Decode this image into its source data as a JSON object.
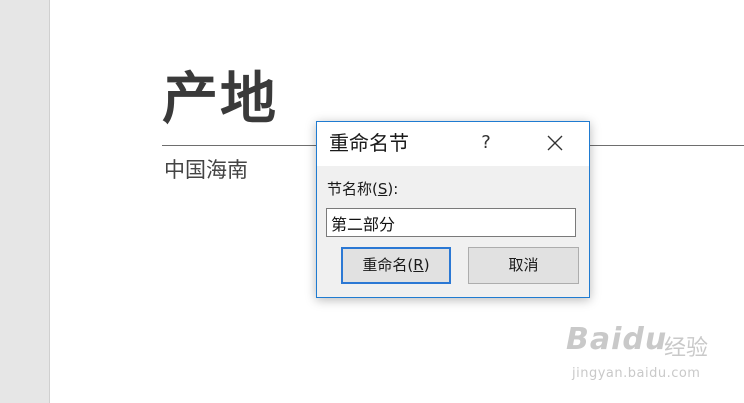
{
  "slide": {
    "title": "产地",
    "subtitle": "中国海南"
  },
  "dialog": {
    "title": "重命名节",
    "help_label": "?",
    "field_label_prefix": "节名称(",
    "field_label_mnemonic": "S",
    "field_label_suffix": "):",
    "input_value": "第二部分",
    "rename_prefix": "重命名(",
    "rename_mnemonic": "R",
    "rename_suffix": ")",
    "cancel_label": "取消"
  },
  "watermark": {
    "logo": "Baidu",
    "jingyan": "经验",
    "url": "jingyan.baidu.com"
  },
  "colors": {
    "dialog_border": "#1f7bd1",
    "default_button_border": "#2b78d4"
  }
}
